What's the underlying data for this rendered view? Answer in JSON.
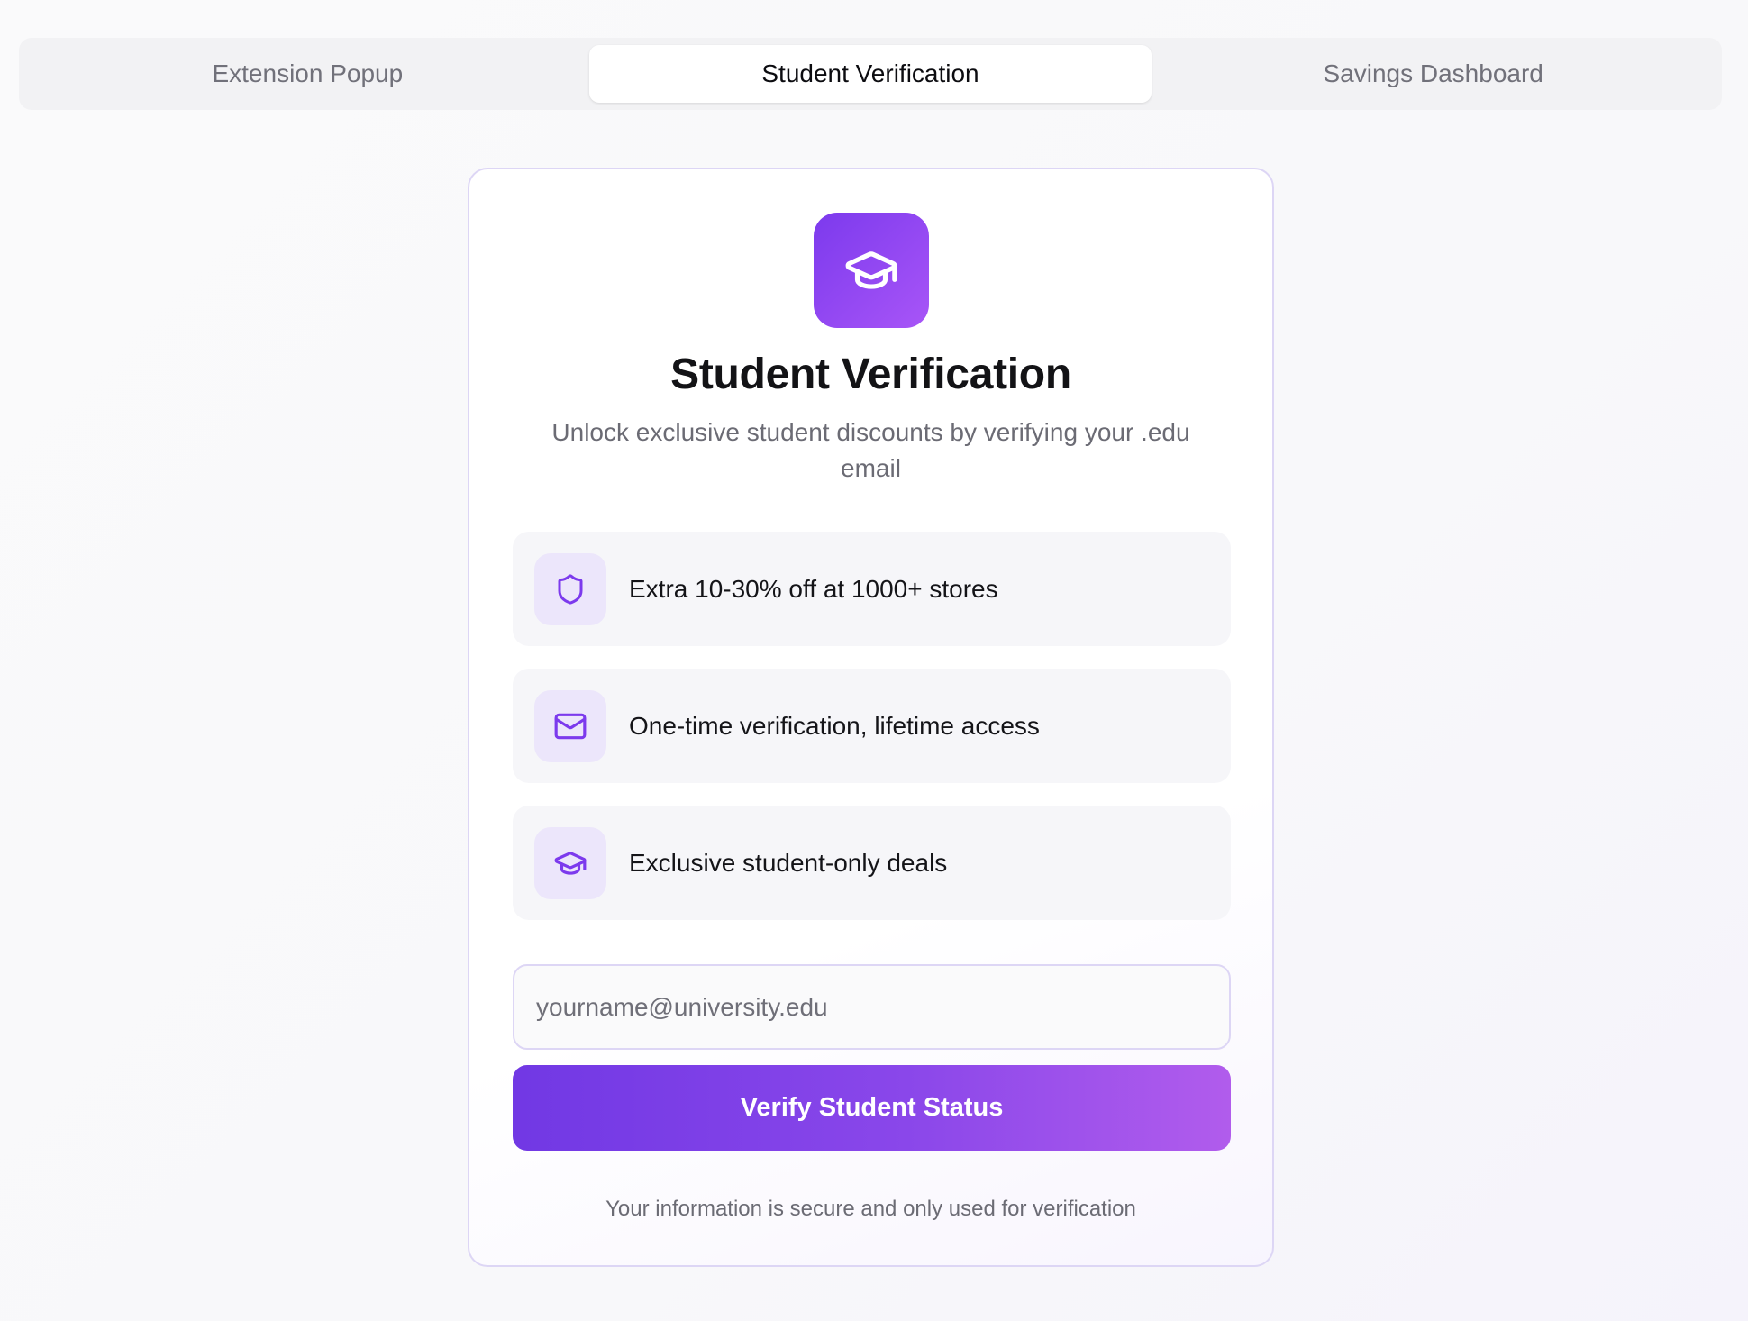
{
  "tabs": [
    {
      "label": "Extension Popup",
      "active": false
    },
    {
      "label": "Student Verification",
      "active": true
    },
    {
      "label": "Savings Dashboard",
      "active": false
    }
  ],
  "card": {
    "logo_icon": "graduation-cap-icon",
    "title": "Student Verification",
    "subtitle": "Unlock exclusive student discounts by verifying your .edu email",
    "features": [
      {
        "icon": "shield-icon",
        "text": "Extra 10-30% off at 1000+ stores"
      },
      {
        "icon": "mail-icon",
        "text": "One-time verification, lifetime access"
      },
      {
        "icon": "graduation-cap-icon",
        "text": "Exclusive student-only deals"
      }
    ],
    "email": {
      "value": "",
      "placeholder": "yourname@university.edu"
    },
    "verify_button": "Verify Student Status",
    "footnote": "Your information is secure and only used for verification"
  },
  "colors": {
    "accent": "#7c3aed",
    "accent_light": "#a855f7",
    "icon_bg": "#ece6fb",
    "card_border": "#ddd6f5"
  }
}
